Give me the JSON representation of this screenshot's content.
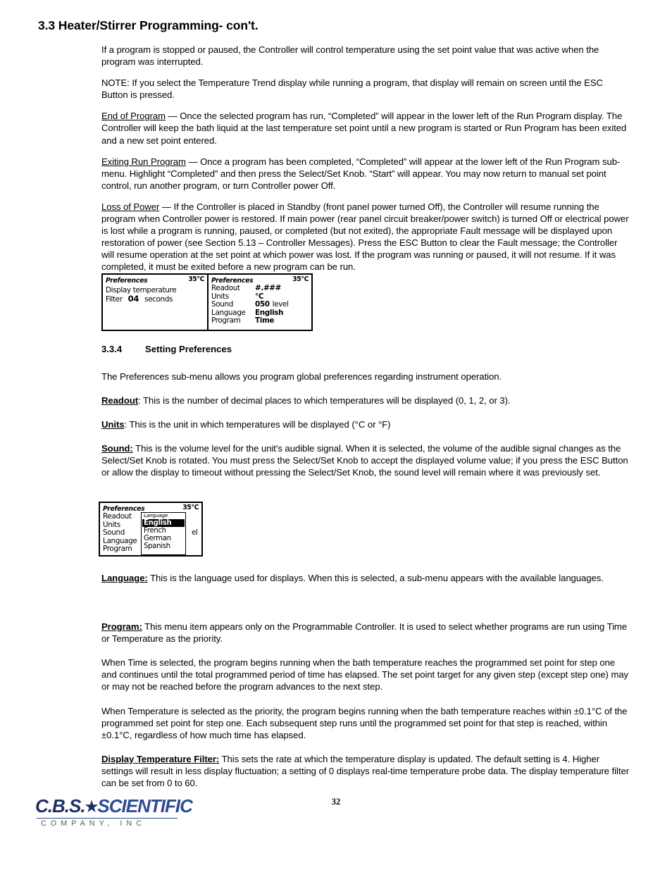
{
  "document": {
    "section_title": "3.3 Heater/Stirrer Programming- con't.",
    "page_number": "32"
  },
  "paragraphs": {
    "p1": "If a program is stopped or paused, the Controller will control temperature using the set point value that was active when the program was interrupted.",
    "p2": "NOTE: If you select the Temperature Trend display while running a program, that display will remain on screen until the ESC Button is pressed.",
    "p3_label": "End of Program",
    "p3_text": " — Once the selected program has run, “Completed” will appear in the lower left of the Run Program display. The Controller will keep the bath liquid at the last temperature set point until a new program is started or Run Program has been exited and a new set point entered.",
    "p4_label": "Exiting Run Program",
    "p4_text": " — Once a program has been completed, “Completed” will appear at the lower left of the Run Program sub-menu. Highlight “Completed” and then press the Select/Set Knob. “Start” will appear. You may now return to manual set point control, run another program, or turn Controller power Off.",
    "p5_label": "Loss of Power",
    "p5_text": " — If the Controller is placed in Standby (front panel power turned Off), the Controller will resume running the program when Controller power is restored. If main power (rear panel circuit breaker/power switch) is turned Off or electrical power is lost while a program is running, paused, or completed (but not exited), the appropriate Fault message will be displayed upon restoration of power (see Section 5.13 – Controller Messages). Press the ESC Button to clear the Fault message; the Controller will resume operation at the set point at which power was lost. If the program was running or paused, it will not resume. If it was completed, it must be exited before a new program can be run."
  },
  "subsection": {
    "number": "3.3.4",
    "title": "Setting Preferences",
    "intro": "The Preferences sub-menu allows you program global preferences regarding instrument operation.",
    "readout_label": "Readout",
    "readout_text": ": This is the number of decimal places to which temperatures will be displayed (0, 1, 2, or 3).",
    "units_label": "Units",
    "units_text": ": This is the unit in which temperatures will be displayed (°C or °F)",
    "sound_label": "Sound:",
    "sound_text": " This is the volume level for the unit's audible signal. When it is selected, the volume of the audible signal changes as the Select/Set Knob is rotated. You must press the Select/Set Knob to accept the displayed volume value; if you press the ESC Button or allow the display to timeout without pressing the Select/Set Knob, the sound level will remain where it was previously set.",
    "language_label": "Language:",
    "language_text": " This is the language used for displays. When this is selected, a sub-menu appears with the available languages.",
    "program_label": "Program:",
    "program_text": " This menu item appears only on the Programmable Controller. It is used to select whether programs are run using Time or Temperature as the priority.",
    "time_para": "When Time is selected, the program begins running when the bath temperature reaches the programmed set point for step one and continues until the total programmed period of time has elapsed. The set point target for any given step (except step one) may or may not be reached before the program advances to the next step.",
    "temp_para": "When Temperature is selected as the priority, the program begins running when the bath temperature reaches within ±0.1°C of the programmed set point for step one. Each subsequent step runs until the programmed set point for that step is reached, within ±0.1°C, regardless of how much time has elapsed.",
    "filter_label": "Display Temperature Filter:",
    "filter_text": " This sets the rate at which the temperature display is updated.   The default setting is 4. Higher settings will result in less display fluctuation; a setting of 0 displays real-time temperature probe data.  The display temperature filter can be set from 0 to 60."
  },
  "figure1": {
    "left_panel": {
      "title": "Preferences",
      "temperature": "35°C",
      "line1": "Display temperature",
      "filter_label": "Filter",
      "filter_value": "04",
      "filter_units": "seconds"
    },
    "right_panel": {
      "title": "Preferences",
      "temperature": "35°C",
      "rows": [
        {
          "label": "Readout",
          "value": "#.###",
          "suffix": ""
        },
        {
          "label": "Units",
          "value": "°C",
          "suffix": ""
        },
        {
          "label": "Sound",
          "value": "050",
          "suffix": "level"
        },
        {
          "label": "Language",
          "value": "English",
          "suffix": ""
        },
        {
          "label": "Program",
          "value": "Time",
          "suffix": ""
        }
      ]
    }
  },
  "figure2": {
    "panel": {
      "title": "Preferences",
      "temperature": "35°C",
      "rows": [
        {
          "label": "Readout"
        },
        {
          "label": "Units"
        },
        {
          "label": "Sound"
        },
        {
          "label": "Language"
        },
        {
          "label": "Program"
        }
      ],
      "partial_value": "el"
    },
    "submenu": {
      "title": "Language",
      "items": [
        "English",
        "French",
        "German",
        "Spanish"
      ],
      "selected": "English"
    }
  },
  "footer": {
    "logo_cbs": "C.B.S.",
    "logo_star": "★",
    "logo_scientific": "SCIENTIFIC",
    "logo_subtitle": "COMPANY, INC"
  }
}
